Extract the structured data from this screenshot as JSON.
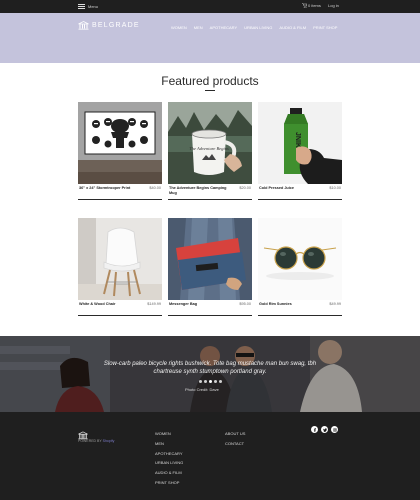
{
  "topbar": {
    "menu_label": "Menu",
    "cart_label": "0 items",
    "login_label": "Log in"
  },
  "brand": {
    "name": "BELGRADE"
  },
  "nav": [
    {
      "label": "WOMEN"
    },
    {
      "label": "MEN"
    },
    {
      "label": "APOTHECARY"
    },
    {
      "label": "URBAN LIVING"
    },
    {
      "label": "AUDIO & FILM"
    },
    {
      "label": "PRINT SHOP"
    }
  ],
  "featured": {
    "title": "Featured products",
    "products": [
      {
        "name": "36\" x 24\" Stormtrooper Print",
        "price": "$40.00"
      },
      {
        "name": "The Adventure Begins Camping Mug",
        "price": "$20.00"
      },
      {
        "name": "Cold Pressed Juice",
        "price": "$10.00"
      },
      {
        "name": "White & Wood Chair",
        "price": "$149.99"
      },
      {
        "name": "Messenger Bag",
        "price": "$95.00"
      },
      {
        "name": "Gold Rim Sunnies",
        "price": "$49.99"
      }
    ]
  },
  "product_art": {
    "mug_text": "The Adventure Begins",
    "juice_text": "JNIK"
  },
  "hero": {
    "quote": "Slow-carb paleo bicycle rights bushwick. Tote bag mustache man bun swag, tbh chartreuse synth stumptown portland gray.",
    "caption": "Photo Credit: Dave"
  },
  "footer": {
    "powered_prefix": "POWERED BY",
    "powered_link": "Shopify",
    "col1": [
      "WOMEN",
      "MEN",
      "APOTHECARY",
      "URBAN LIVING",
      "AUDIO & FILM",
      "PRINT SHOP"
    ],
    "col2": [
      "ABOUT US",
      "CONTACT"
    ],
    "social": [
      "facebook-icon",
      "twitter-icon",
      "instagram-icon"
    ]
  },
  "colors": {
    "header_bg": "#c4c3dc",
    "topbar_bg": "#1f1f1f",
    "footer_bg": "#1f1f1f",
    "link_accent": "#7c7cc9"
  }
}
